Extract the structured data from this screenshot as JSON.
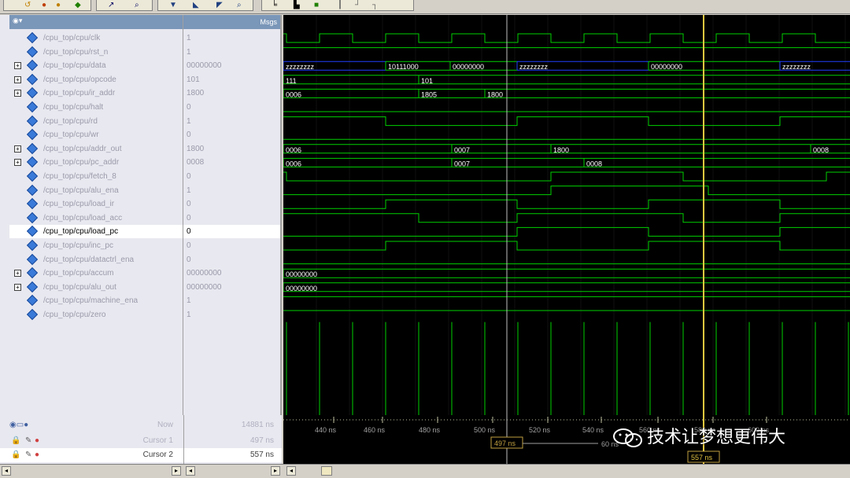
{
  "header": {
    "msgs_label": "Msgs"
  },
  "signals": [
    {
      "name": "/cpu_top/cpu/clk",
      "value": "1",
      "bus": false
    },
    {
      "name": "/cpu_top/cpu/rst_n",
      "value": "1",
      "bus": false
    },
    {
      "name": "/cpu_top/cpu/data",
      "value": "00000000",
      "bus": true
    },
    {
      "name": "/cpu_top/cpu/opcode",
      "value": "101",
      "bus": true
    },
    {
      "name": "/cpu_top/cpu/ir_addr",
      "value": "1800",
      "bus": true
    },
    {
      "name": "/cpu_top/cpu/halt",
      "value": "0",
      "bus": false
    },
    {
      "name": "/cpu_top/cpu/rd",
      "value": "1",
      "bus": false
    },
    {
      "name": "/cpu_top/cpu/wr",
      "value": "0",
      "bus": false
    },
    {
      "name": "/cpu_top/cpu/addr_out",
      "value": "1800",
      "bus": true
    },
    {
      "name": "/cpu_top/cpu/pc_addr",
      "value": "0008",
      "bus": true
    },
    {
      "name": "/cpu_top/cpu/fetch_8",
      "value": "0",
      "bus": false
    },
    {
      "name": "/cpu_top/cpu/alu_ena",
      "value": "1",
      "bus": false
    },
    {
      "name": "/cpu_top/cpu/load_ir",
      "value": "0",
      "bus": false
    },
    {
      "name": "/cpu_top/cpu/load_acc",
      "value": "0",
      "bus": false
    },
    {
      "name": "/cpu_top/cpu/load_pc",
      "value": "0",
      "bus": false
    },
    {
      "name": "/cpu_top/cpu/inc_pc",
      "value": "0",
      "bus": false
    },
    {
      "name": "/cpu_top/cpu/datactrl_ena",
      "value": "0",
      "bus": false
    },
    {
      "name": "/cpu_top/cpu/accum",
      "value": "00000000",
      "bus": true
    },
    {
      "name": "/cpu_top/cpu/alu_out",
      "value": "00000000",
      "bus": true
    },
    {
      "name": "/cpu_top/cpu/machine_ena",
      "value": "1",
      "bus": false
    },
    {
      "name": "/cpu_top/cpu/zero",
      "value": "1",
      "bus": false
    }
  ],
  "bus_labels": {
    "data": [
      "zzzzzzzz",
      "10111000",
      "00000000",
      "zzzzzzzz",
      "00000000",
      "zzzzzzzz"
    ],
    "opcode": [
      "111",
      "101"
    ],
    "ir_addr": [
      "0006",
      "1805",
      "1800"
    ],
    "addr_out": [
      "0006",
      "0007",
      "1800",
      "0008"
    ],
    "pc_addr": [
      "0006",
      "0007",
      "0008"
    ],
    "accum": [
      "00000000"
    ],
    "alu_out": [
      "00000000"
    ]
  },
  "cursors": {
    "now_label": "Now",
    "now_value": "14881 ns",
    "cursor1_label": "Cursor 1",
    "cursor1_value": "497 ns",
    "cursor2_label": "Cursor 2",
    "cursor2_value": "557 ns",
    "cursor1_flag": "497 ns",
    "cursor2_flag": "557 ns",
    "delta": "60 ns"
  },
  "timeline": {
    "ticks": [
      "440 ns",
      "460 ns",
      "480 ns",
      "500 ns",
      "520 ns",
      "540 ns",
      "560 ns",
      "580 ns",
      "600 ns"
    ]
  },
  "watermark": {
    "text": "技术让梦想更伟大"
  },
  "colors": {
    "wave": "#00d000",
    "bus_line": "#2040ff",
    "cursor": "#e8c840",
    "bus_text": "#ffffff"
  }
}
